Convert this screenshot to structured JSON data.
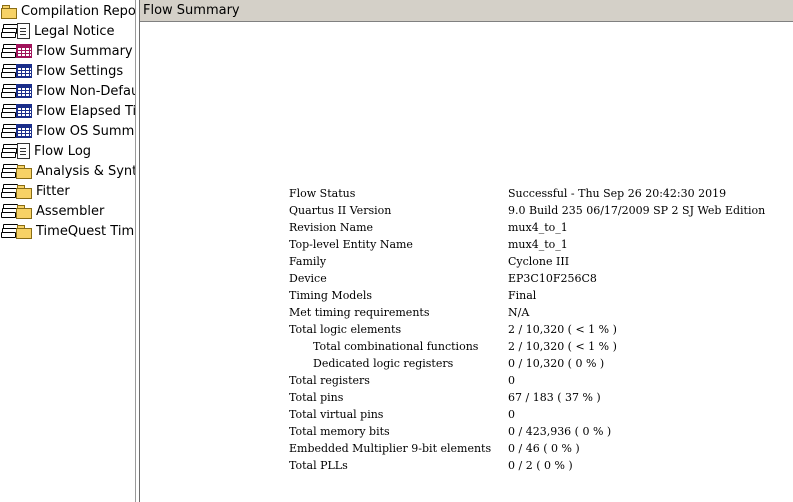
{
  "tree": {
    "items": [
      {
        "label": "Compilation Report",
        "icon": "folder-icon"
      },
      {
        "label": "Legal Notice",
        "icon": "document-icon"
      },
      {
        "label": "Flow Summary",
        "icon": "table-icon"
      },
      {
        "label": "Flow Settings",
        "icon": "table-icon"
      },
      {
        "label": "Flow Non-Default",
        "icon": "table-icon"
      },
      {
        "label": "Flow Elapsed Time",
        "icon": "table-icon"
      },
      {
        "label": "Flow OS Summary",
        "icon": "table-icon"
      },
      {
        "label": "Flow Log",
        "icon": "document-icon"
      },
      {
        "label": "Analysis & Synthesis",
        "icon": "folder-icon"
      },
      {
        "label": "Fitter",
        "icon": "folder-icon"
      },
      {
        "label": "Assembler",
        "icon": "folder-icon"
      },
      {
        "label": "TimeQuest Timing Analyzer",
        "icon": "folder-icon"
      }
    ]
  },
  "panel": {
    "title": "Flow Summary",
    "rows": [
      {
        "key": "Flow Status",
        "value": "Successful - Thu Sep 26 20:42:30 2019"
      },
      {
        "key": "Quartus II Version",
        "value": "9.0 Build 235 06/17/2009 SP 2 SJ Web Edition"
      },
      {
        "key": "Revision Name",
        "value": "mux4_to_1"
      },
      {
        "key": "Top-level Entity Name",
        "value": "mux4_to_1"
      },
      {
        "key": "Family",
        "value": "Cyclone III"
      },
      {
        "key": "Device",
        "value": "EP3C10F256C8"
      },
      {
        "key": "Timing Models",
        "value": "Final"
      },
      {
        "key": "Met timing requirements",
        "value": "N/A"
      },
      {
        "key": "Total logic elements",
        "value": "2 / 10,320 ( < 1 % )"
      },
      {
        "key": "Total combinational functions",
        "value": "2 / 10,320 ( < 1 % )"
      },
      {
        "key": "Dedicated logic registers",
        "value": "0 / 10,320 ( 0 % )"
      },
      {
        "key": "Total registers",
        "value": "0"
      },
      {
        "key": "Total pins",
        "value": "67 / 183 ( 37 % )"
      },
      {
        "key": "Total virtual pins",
        "value": "0"
      },
      {
        "key": "Total memory bits",
        "value": "0 / 423,936 ( 0 % )"
      },
      {
        "key": "Embedded Multiplier 9-bit elements",
        "value": "0 / 46 ( 0 % )"
      },
      {
        "key": "Total PLLs",
        "value": "0 / 2 ( 0 % )"
      }
    ]
  }
}
